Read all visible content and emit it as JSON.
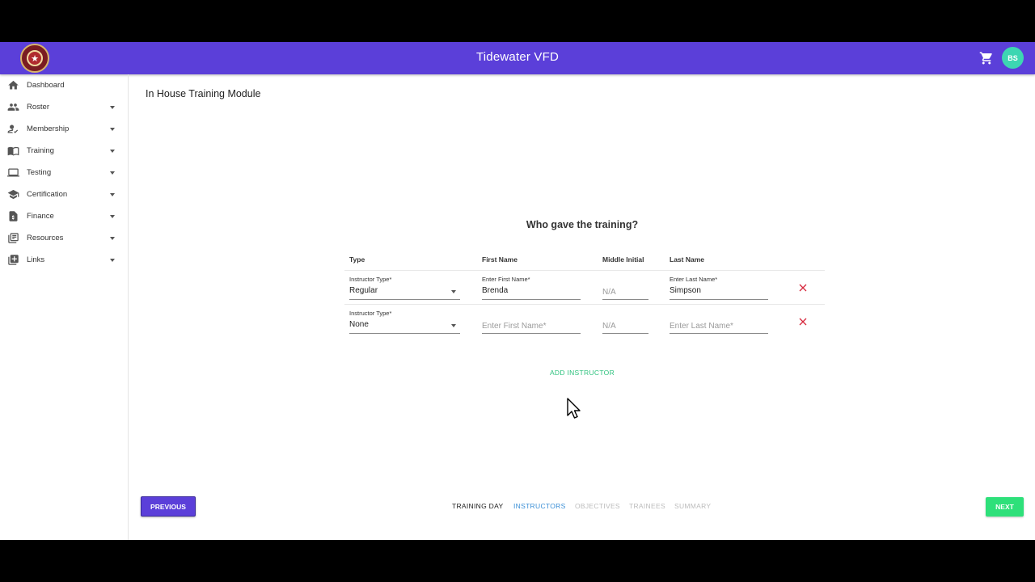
{
  "app": {
    "title": "Tidewater VFD",
    "avatar_initials": "BS",
    "brand_color": "#5b3fd9"
  },
  "sidebar": {
    "items": [
      {
        "label": "Dashboard",
        "icon": "home-icon"
      },
      {
        "label": "Roster",
        "icon": "people-icon"
      },
      {
        "label": "Membership",
        "icon": "person-check-icon"
      },
      {
        "label": "Training",
        "icon": "book-icon"
      },
      {
        "label": "Testing",
        "icon": "laptop-icon"
      },
      {
        "label": "Certification",
        "icon": "school-icon"
      },
      {
        "label": "Finance",
        "icon": "receipt-icon"
      },
      {
        "label": "Resources",
        "icon": "library-icon"
      },
      {
        "label": "Links",
        "icon": "links-icon"
      }
    ]
  },
  "main": {
    "page_title": "In House Training Module",
    "question": "Who gave the training?",
    "columns": [
      "Type",
      "First Name",
      "Middle Initial",
      "Last Name"
    ],
    "rows": [
      {
        "type_label": "Instructor Type*",
        "type_value": "Regular",
        "first_label": "Enter First Name*",
        "first_value": "Brenda",
        "first_placeholder": "",
        "middle_placeholder": "N/A",
        "last_label": "Enter Last Name*",
        "last_value": "Simpson",
        "last_placeholder": ""
      },
      {
        "type_label": "Instructor Type*",
        "type_value": "None",
        "first_label": "",
        "first_value": "",
        "first_placeholder": "Enter First Name*",
        "middle_placeholder": "N/A",
        "last_label": "",
        "last_value": "",
        "last_placeholder": "Enter Last Name*"
      }
    ],
    "add_instructor_label": "ADD INSTRUCTOR"
  },
  "footer": {
    "previous_label": "PREVIOUS",
    "next_label": "NEXT",
    "steps": [
      "TRAINING DAY",
      "INSTRUCTORS",
      "OBJECTIVES",
      "TRAINEES",
      "SUMMARY"
    ]
  }
}
